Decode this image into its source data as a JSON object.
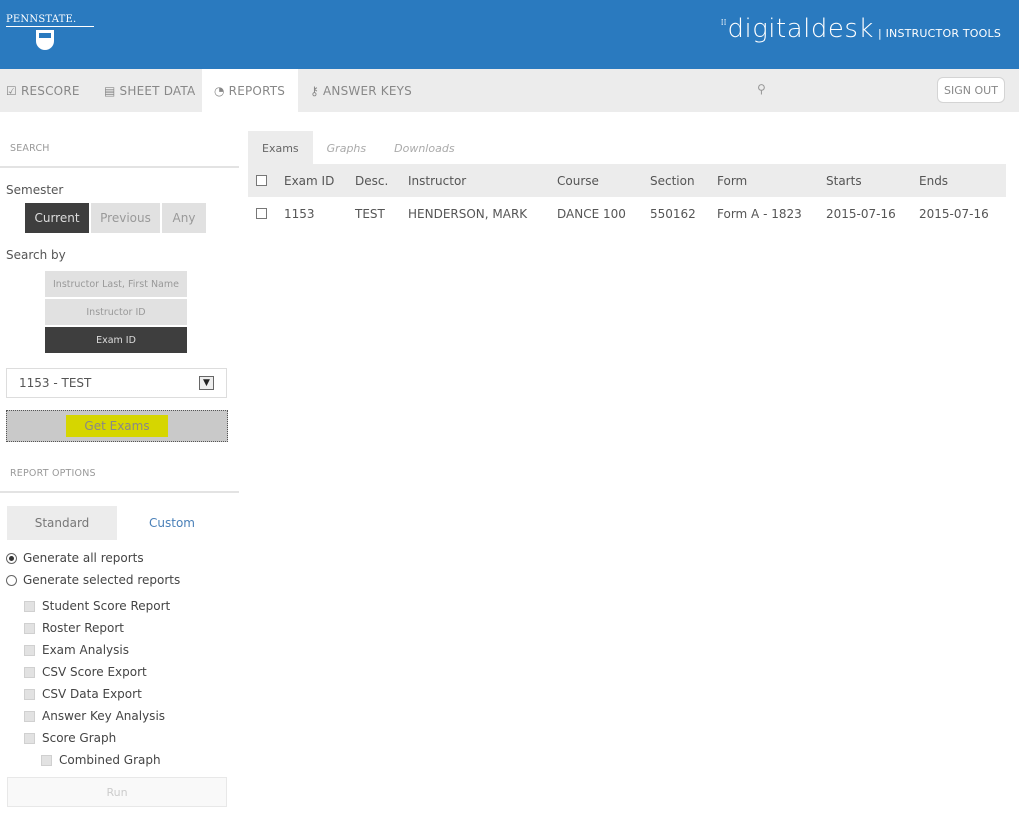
{
  "header": {
    "left_logo": "PENNSTATE.",
    "brand": "digitaldesk",
    "brand_suffix": "| INSTRUCTOR TOOLS",
    "colors": {
      "header_bg": "#2a7abf",
      "nav_bg": "#ececec",
      "active_dark": "#3e3e3e",
      "highlight": "#d6d600",
      "link": "#4a80b8"
    }
  },
  "nav": {
    "items": [
      {
        "label": "RESCORE",
        "icon": "checkbox-icon"
      },
      {
        "label": "SHEET DATA",
        "icon": "document-icon"
      },
      {
        "label": "REPORTS",
        "icon": "pie-chart-icon",
        "active": true
      },
      {
        "label": "ANSWER KEYS",
        "icon": "key-icon"
      }
    ],
    "user_name": "",
    "sign_out": "SIGN OUT"
  },
  "sidebar": {
    "search_title": "SEARCH",
    "semester_label": "Semester",
    "semester_options": [
      "Current",
      "Previous",
      "Any"
    ],
    "semester_selected": "Current",
    "search_by_label": "Search by",
    "search_by_options": [
      "Instructor Last, First Name",
      "Instructor ID",
      "Exam ID"
    ],
    "search_by_selected": "Exam ID",
    "exam_select_value": "1153 - TEST",
    "get_exams": "Get Exams",
    "report_options_title": "REPORT OPTIONS",
    "report_tabs": [
      "Standard",
      "Custom"
    ],
    "radios": [
      {
        "label": "Generate all reports",
        "checked": true
      },
      {
        "label": "Generate selected reports",
        "checked": false
      }
    ],
    "reports": [
      "Student Score Report",
      "Roster Report",
      "Exam Analysis",
      "CSV Score Export",
      "CSV Data Export",
      "Answer Key Analysis",
      "Score Graph"
    ],
    "sub_report": "Combined Graph",
    "run": "Run"
  },
  "main": {
    "tabs": [
      "Exams",
      "Graphs",
      "Downloads"
    ],
    "active_tab": "Exams",
    "columns": [
      "Exam ID",
      "Desc.",
      "Instructor",
      "Course",
      "Section",
      "Form",
      "Starts",
      "Ends"
    ],
    "rows": [
      [
        "1153",
        "TEST",
        "HENDERSON, MARK",
        "DANCE 100",
        "550162",
        "Form A - 1823",
        "2015-07-16",
        "2015-07-16"
      ]
    ]
  }
}
